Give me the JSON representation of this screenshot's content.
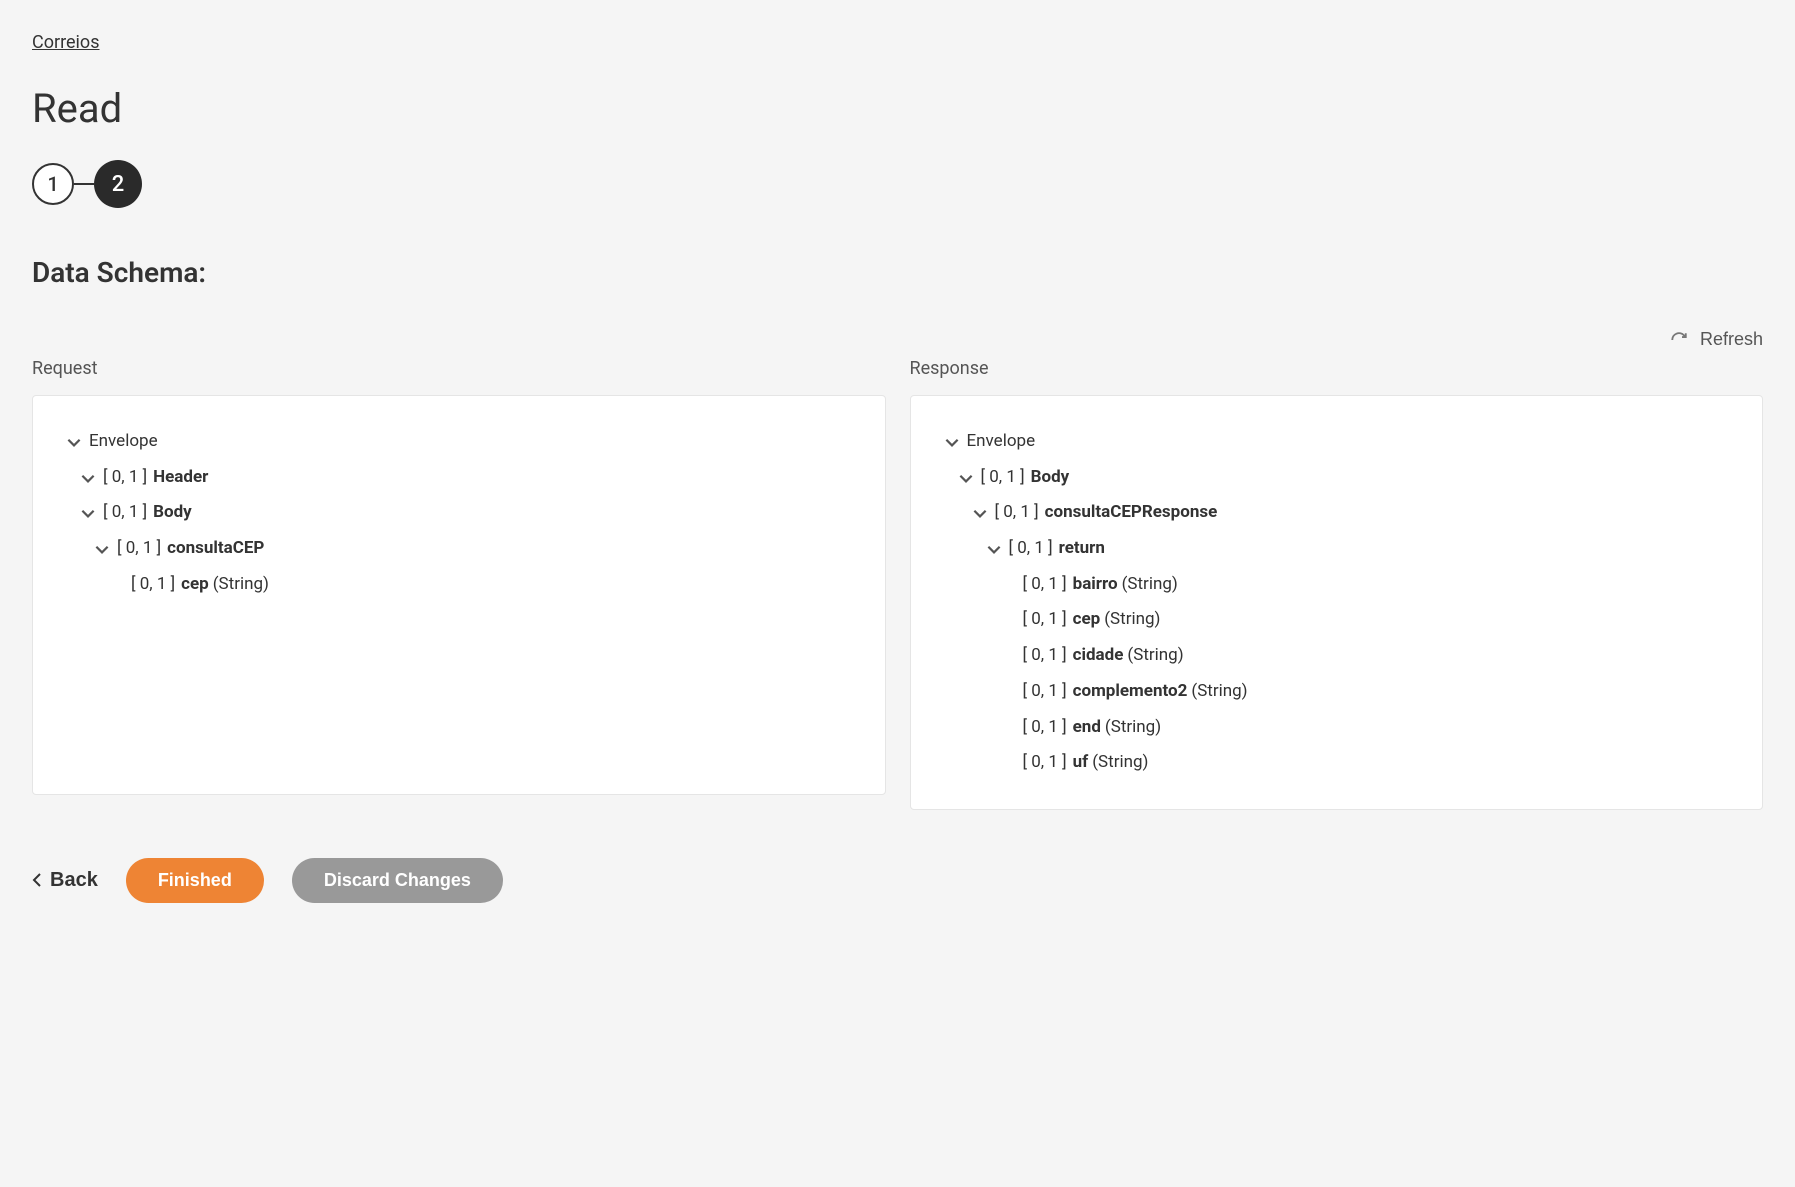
{
  "breadcrumb": "Correios",
  "page_title": "Read",
  "stepper": {
    "step1": "1",
    "step2": "2"
  },
  "section_title": "Data Schema:",
  "refresh_label": "Refresh",
  "request": {
    "label": "Request",
    "tree": [
      {
        "indent": 0,
        "chevron": true,
        "cardinality": "",
        "name": "Envelope",
        "bold": false,
        "type": ""
      },
      {
        "indent": 1,
        "chevron": true,
        "cardinality": "[ 0, 1 ]",
        "name": "Header",
        "bold": true,
        "type": ""
      },
      {
        "indent": 1,
        "chevron": true,
        "cardinality": "[ 0, 1 ]",
        "name": "Body",
        "bold": true,
        "type": ""
      },
      {
        "indent": 2,
        "chevron": true,
        "cardinality": "[ 0, 1 ]",
        "name": "consultaCEP",
        "bold": true,
        "type": ""
      },
      {
        "indent": 3,
        "chevron": false,
        "cardinality": "[ 0, 1 ]",
        "name": "cep",
        "bold": true,
        "type": "(String)"
      }
    ]
  },
  "response": {
    "label": "Response",
    "tree": [
      {
        "indent": 0,
        "chevron": true,
        "cardinality": "",
        "name": "Envelope",
        "bold": false,
        "type": ""
      },
      {
        "indent": 1,
        "chevron": true,
        "cardinality": "[ 0, 1 ]",
        "name": "Body",
        "bold": true,
        "type": ""
      },
      {
        "indent": 2,
        "chevron": true,
        "cardinality": "[ 0, 1 ]",
        "name": "consultaCEPResponse",
        "bold": true,
        "type": ""
      },
      {
        "indent": 3,
        "chevron": true,
        "cardinality": "[ 0, 1 ]",
        "name": "return",
        "bold": true,
        "type": ""
      },
      {
        "indent": 4,
        "chevron": false,
        "cardinality": "[ 0, 1 ]",
        "name": "bairro",
        "bold": true,
        "type": "(String)"
      },
      {
        "indent": 4,
        "chevron": false,
        "cardinality": "[ 0, 1 ]",
        "name": "cep",
        "bold": true,
        "type": "(String)"
      },
      {
        "indent": 4,
        "chevron": false,
        "cardinality": "[ 0, 1 ]",
        "name": "cidade",
        "bold": true,
        "type": "(String)"
      },
      {
        "indent": 4,
        "chevron": false,
        "cardinality": "[ 0, 1 ]",
        "name": "complemento2",
        "bold": true,
        "type": "(String)"
      },
      {
        "indent": 4,
        "chevron": false,
        "cardinality": "[ 0, 1 ]",
        "name": "end",
        "bold": true,
        "type": "(String)"
      },
      {
        "indent": 4,
        "chevron": false,
        "cardinality": "[ 0, 1 ]",
        "name": "uf",
        "bold": true,
        "type": "(String)"
      }
    ]
  },
  "footer": {
    "back": "Back",
    "finished": "Finished",
    "discard": "Discard Changes"
  }
}
